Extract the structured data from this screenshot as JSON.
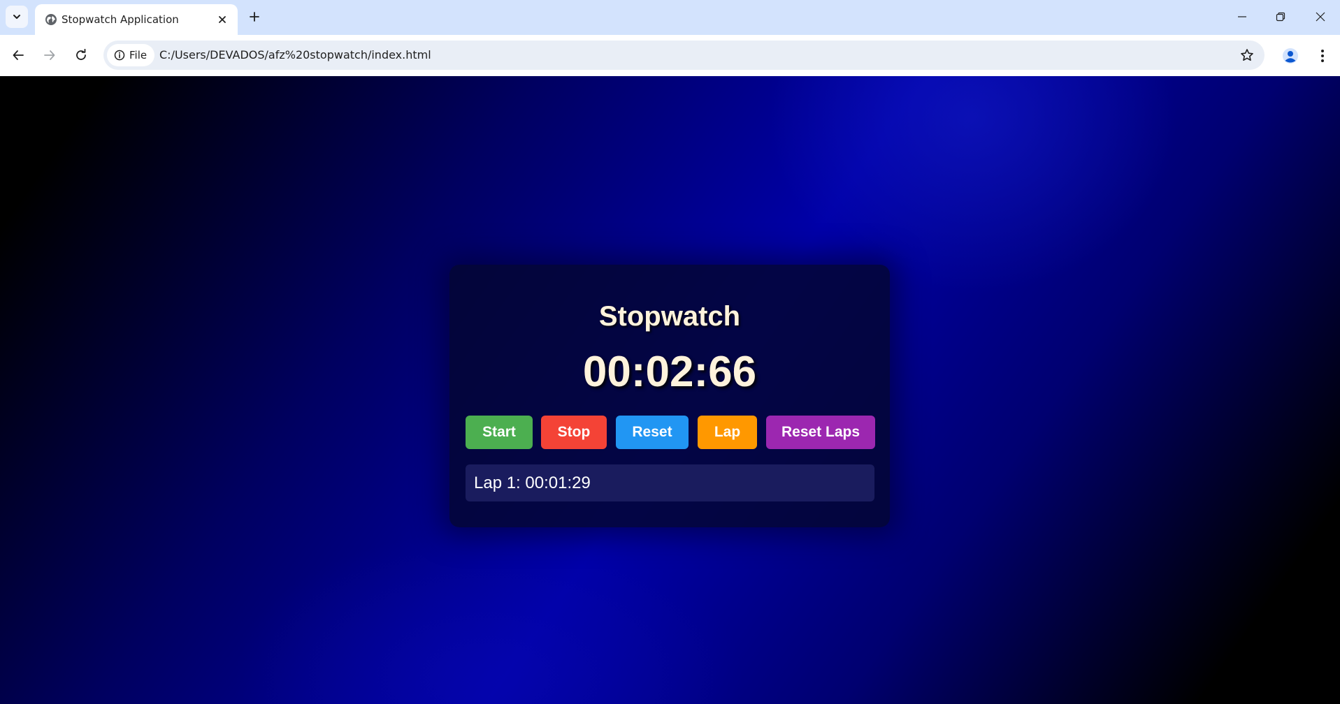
{
  "browser": {
    "tab": {
      "title": "Stopwatch Application",
      "favicon": "globe-icon"
    },
    "omnibox": {
      "site_chip_label": "File",
      "url": "C:/Users/DEVADOS/afz%20stopwatch/index.html"
    },
    "icons": {
      "tab_search": "chevron-down-icon",
      "tab_close": "close-icon",
      "new_tab": "plus-icon",
      "minimize": "minimize-icon",
      "restore": "restore-icon",
      "close_window": "close-icon",
      "back": "arrow-left-icon",
      "forward": "arrow-right-icon",
      "reload": "reload-icon",
      "site_info": "info-icon",
      "bookmark": "star-icon",
      "profile": "person-icon",
      "menu": "kebab-menu-icon"
    },
    "colors": {
      "tabstrip": "#d3e3fd",
      "omnibox": "#e9eef6"
    }
  },
  "app": {
    "title": "Stopwatch",
    "time": "00:02:66",
    "buttons": [
      {
        "id": "start",
        "label": "Start",
        "color": "#4caf50"
      },
      {
        "id": "stop",
        "label": "Stop",
        "color": "#f44336"
      },
      {
        "id": "reset",
        "label": "Reset",
        "color": "#2196f3"
      },
      {
        "id": "lap",
        "label": "Lap",
        "color": "#ff9800"
      },
      {
        "id": "reset-laps",
        "label": "Reset Laps",
        "color": "#9c27b0"
      }
    ],
    "laps": [
      {
        "text": "Lap 1: 00:01:29"
      }
    ],
    "colors": {
      "title_text": "#fff3dc",
      "lap_background": "#1a1c5e"
    }
  }
}
